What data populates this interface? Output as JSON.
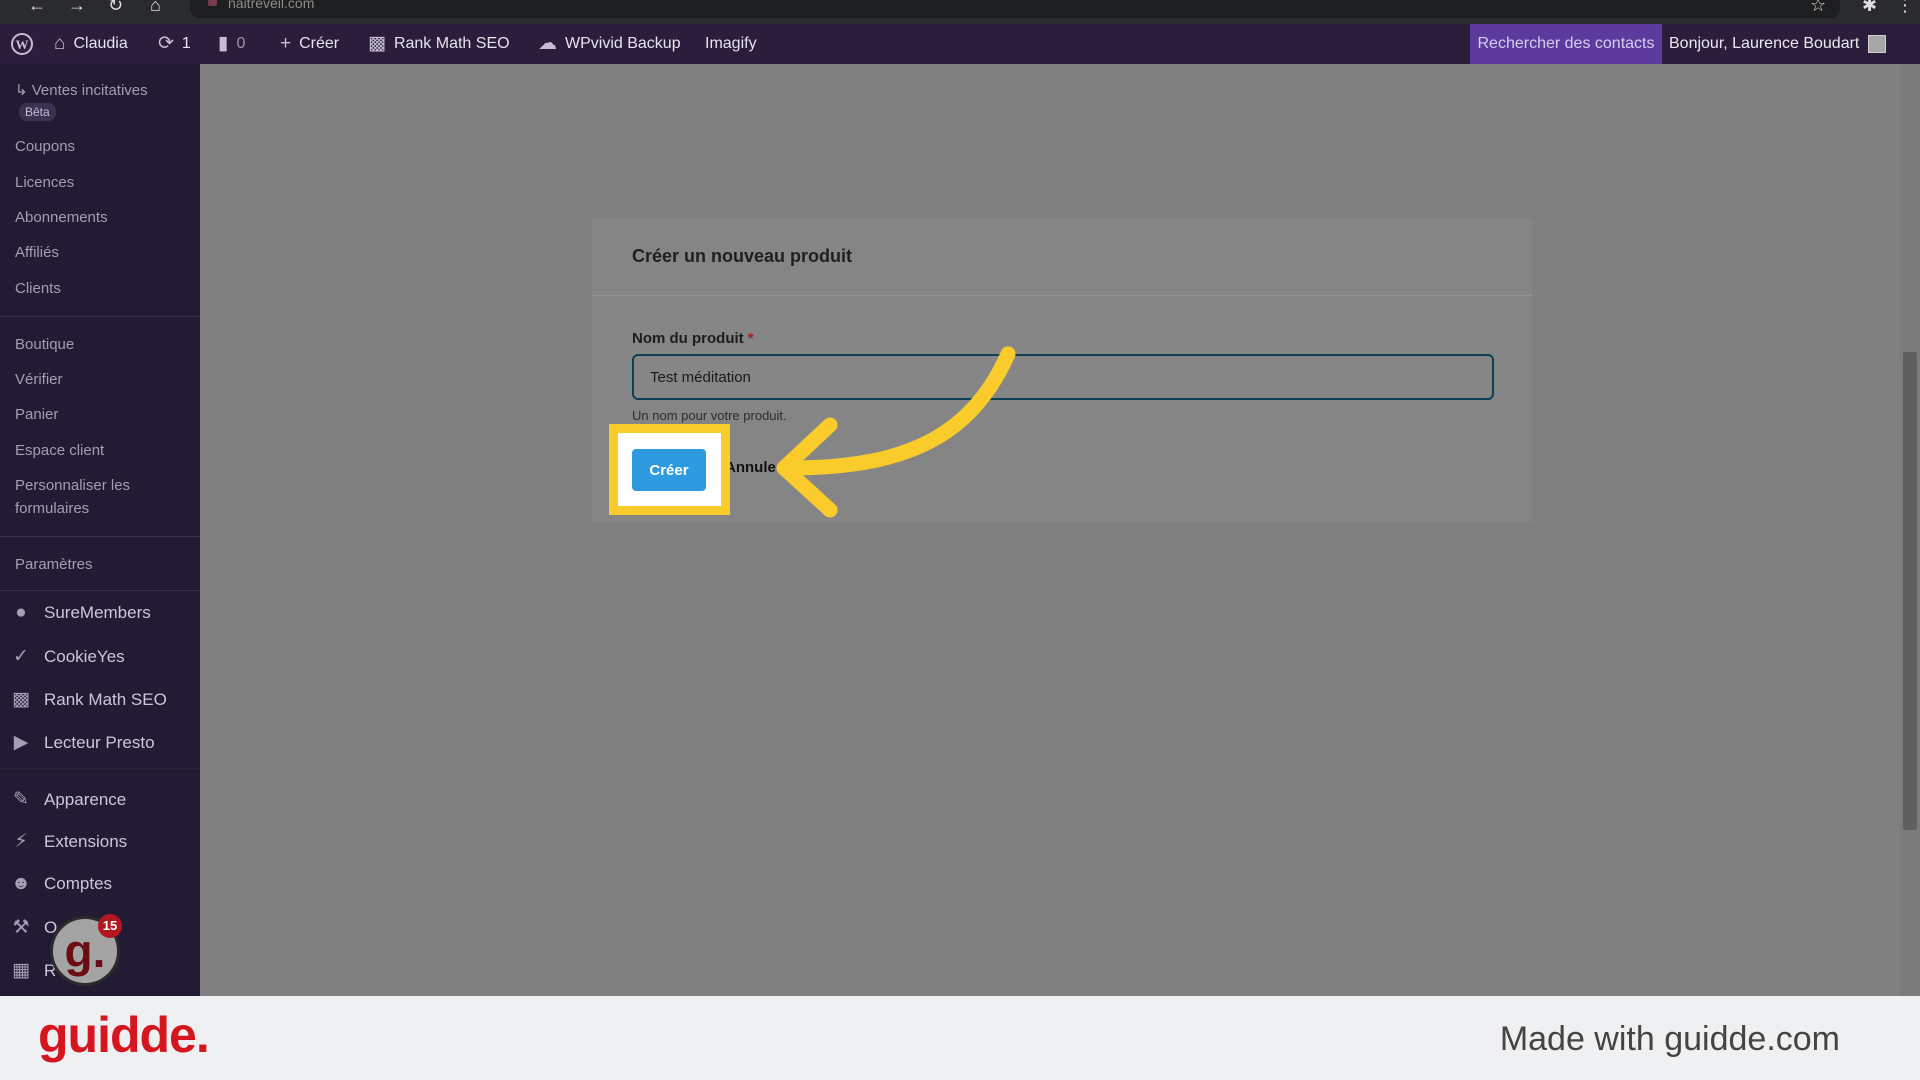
{
  "browser": {
    "url": "naitreveil.com",
    "nav_icons": [
      "back-icon",
      "forward-icon",
      "reload-icon",
      "home-icon"
    ]
  },
  "admin_bar": {
    "site_name": "Claudia",
    "updates_count": "1",
    "comments_count": "0",
    "create_label": "Créer",
    "rank_math_label": "Rank Math SEO",
    "wpvivid_label": "WPvivid Backup",
    "imagify_label": "Imagify",
    "search_contacts_label": "Rechercher des contacts",
    "greeting": "Bonjour, Laurence Boudart"
  },
  "sidebar": {
    "sub_items_top": [
      {
        "label": "↳ Ventes incitatives",
        "badge": "Bêta"
      },
      {
        "label": "Coupons"
      },
      {
        "label": "Licences"
      },
      {
        "label": "Abonnements"
      },
      {
        "label": "Affiliés"
      },
      {
        "label": "Clients"
      }
    ],
    "sub_items_mid": [
      {
        "label": "Boutique"
      },
      {
        "label": "Vérifier"
      },
      {
        "label": "Panier"
      },
      {
        "label": "Espace client"
      },
      {
        "label": "Personnaliser les"
      },
      {
        "label": "formulaires"
      }
    ],
    "settings_label": "Paramètres",
    "main_items": [
      {
        "label": "SureMembers",
        "icon": "suremembers-icon"
      },
      {
        "label": "CookieYes",
        "icon": "cookieyes-icon"
      },
      {
        "label": "Rank Math SEO",
        "icon": "rank-math-icon"
      },
      {
        "label": "Lecteur Presto",
        "icon": "presto-icon"
      },
      {
        "label": "Apparence",
        "icon": "brush-icon"
      },
      {
        "label": "Extensions",
        "icon": "plugin-icon"
      },
      {
        "label": "Comptes",
        "icon": "user-icon"
      },
      {
        "label": "O",
        "icon": "wrench-icon"
      },
      {
        "label": "R",
        "icon": "settings-icon"
      }
    ]
  },
  "modal": {
    "title": "Créer un nouveau produit",
    "field_label": "Nom du produit",
    "required_mark": "*",
    "field_value": "Test méditation",
    "help_text": "Un nom pour votre produit.",
    "create_button": "Créer",
    "cancel_link": "Annule"
  },
  "guidde_badge": {
    "letter": "g.",
    "count": "15"
  },
  "footer": {
    "logo": "guidde.",
    "made_with": "Made with guidde.com"
  },
  "colors": {
    "highlight": "#f9cc2b",
    "arrow": "#f9cc2b",
    "admin_bar": "#2a1e3c",
    "sidebar": "#231a33",
    "button": "#2e9be0",
    "brand_red": "#d5161f"
  }
}
